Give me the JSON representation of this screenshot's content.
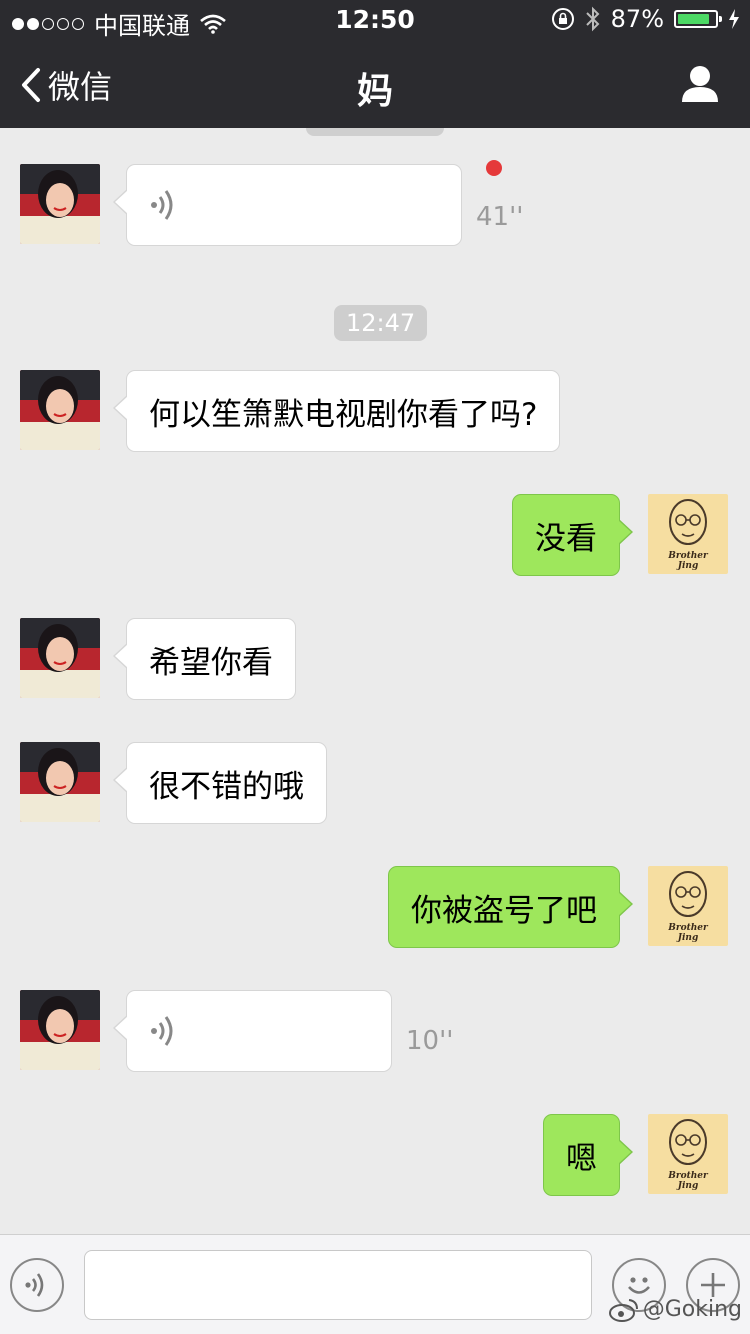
{
  "status_bar": {
    "carrier": "中国联通",
    "time": "12:50",
    "battery": "87%",
    "battery_level": 0.87
  },
  "nav": {
    "back_label": "微信",
    "title": "妈"
  },
  "chat": {
    "timestamp": "12:47",
    "messages": [
      {
        "side": "in",
        "type": "voice",
        "duration": "41''",
        "unread": true
      },
      {
        "side": "in",
        "type": "text",
        "text": "何以笙箫默电视剧你看了吗?"
      },
      {
        "side": "out",
        "type": "text",
        "text": "没看"
      },
      {
        "side": "in",
        "type": "text",
        "text": "希望你看"
      },
      {
        "side": "in",
        "type": "text",
        "text": "很不错的哦"
      },
      {
        "side": "out",
        "type": "text",
        "text": "你被盗号了吧"
      },
      {
        "side": "in",
        "type": "voice",
        "duration": "10''",
        "unread": false
      },
      {
        "side": "out",
        "type": "text",
        "text": "嗯"
      }
    ]
  },
  "avatar_right": {
    "line1": "Brother",
    "line2": "Jing"
  },
  "watermark": "@Goking",
  "colors": {
    "header_bg": "#2b2b2f",
    "chat_bg": "#ebebeb",
    "out_bubble": "#9ee75c",
    "in_bubble": "#ffffff",
    "unread_dot": "#e5393a",
    "battery_fill": "#4cd964"
  },
  "icons": [
    "wifi-icon",
    "orientation-lock-icon",
    "bluetooth-icon",
    "back-chevron-icon",
    "profile-icon",
    "voice-wave-icon",
    "voice-mode-icon",
    "emoji-icon",
    "plus-icon",
    "weibo-icon"
  ]
}
